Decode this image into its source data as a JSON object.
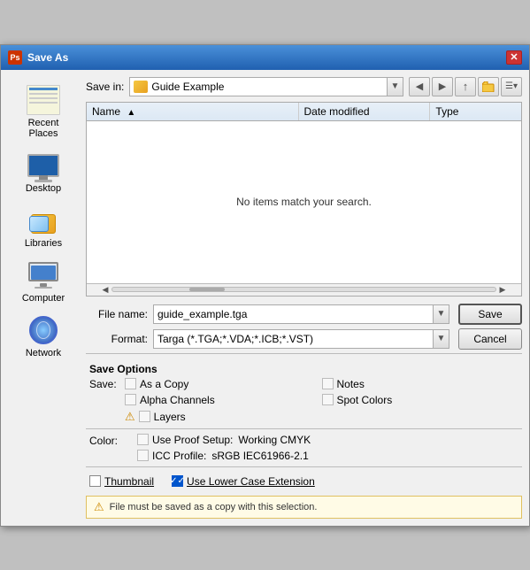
{
  "dialog": {
    "title": "Save As",
    "titlebar_icon": "Ps"
  },
  "savein": {
    "label": "Save in:",
    "folder_name": "Guide Example"
  },
  "nav_buttons": {
    "back": "◀",
    "forward": "▶",
    "up": "↑",
    "new_folder": "📁",
    "views": "☰"
  },
  "file_list": {
    "col_name": "Name",
    "col_date": "Date modified",
    "col_type": "Type",
    "empty_message": "No items match your search.",
    "sort_indicator": "▲"
  },
  "form": {
    "filename_label": "File name:",
    "filename_value": "guide_example.tga",
    "format_label": "Format:",
    "format_value": "Targa (*.TGA;*.VDA;*.ICB;*.VST)",
    "save_button": "Save",
    "cancel_button": "Cancel"
  },
  "save_options": {
    "title": "Save Options",
    "save_label": "Save:",
    "as_a_copy_label": "As a Copy",
    "alpha_channels_label": "Alpha Channels",
    "layers_label": "Layers",
    "notes_label": "Notes",
    "spot_colors_label": "Spot Colors",
    "as_a_copy_checked": false,
    "alpha_channels_checked": false,
    "layers_checked": false,
    "notes_checked": false,
    "spot_colors_checked": false,
    "layers_has_warning": true
  },
  "color": {
    "label": "Color:",
    "proof_setup_label": "Use Proof Setup:",
    "proof_setup_value": "Working CMYK",
    "icc_profile_label": "ICC Profile:",
    "icc_profile_value": "sRGB IEC61966-2.1",
    "proof_checked": false,
    "icc_checked": false
  },
  "bottom": {
    "thumbnail_label": "Thumbnail",
    "thumbnail_checked": false,
    "lower_case_label": "Use Lower Case Extension",
    "lower_case_checked": true
  },
  "warning": {
    "text": "File must be saved as a copy with this selection.",
    "icon": "⚠"
  },
  "sidebar": {
    "items": [
      {
        "label": "Recent Places",
        "icon": "recent"
      },
      {
        "label": "Desktop",
        "icon": "desktop"
      },
      {
        "label": "Libraries",
        "icon": "libraries"
      },
      {
        "label": "Computer",
        "icon": "computer"
      },
      {
        "label": "Network",
        "icon": "network"
      }
    ]
  }
}
